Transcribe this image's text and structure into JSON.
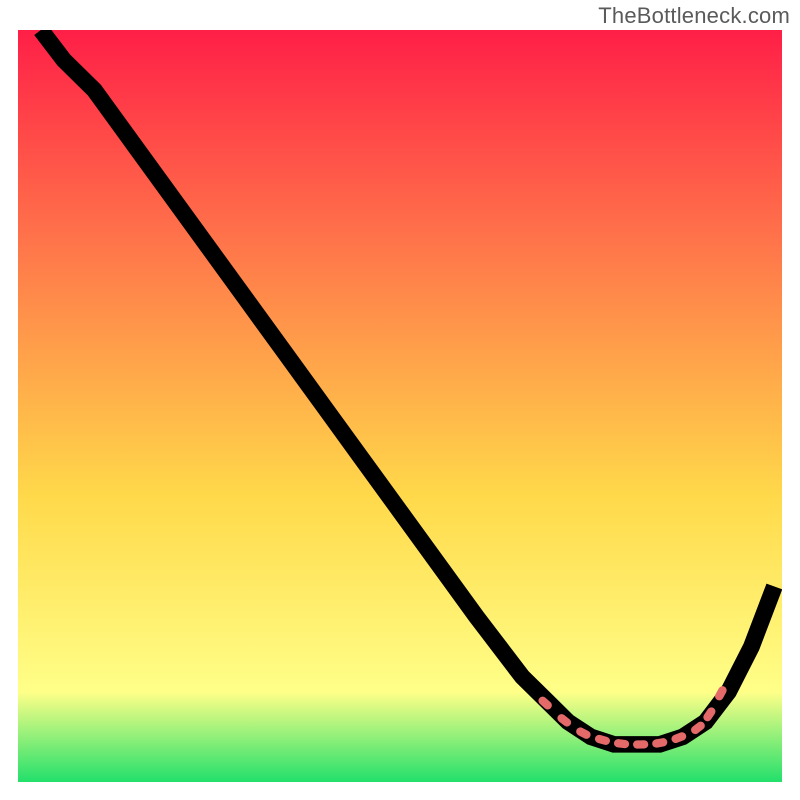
{
  "watermark": "TheBottleneck.com",
  "colors": {
    "grad_top": "#ff1f47",
    "grad_mid1": "#ff7a4a",
    "grad_mid2": "#ffd94a",
    "grad_mid3": "#ffff88",
    "grad_bottom": "#22e06b",
    "curve": "#000000",
    "bead": "#e46a6a"
  },
  "chart_data": {
    "type": "line",
    "title": "",
    "xlabel": "",
    "ylabel": "",
    "xlim": [
      0,
      100
    ],
    "ylim": [
      0,
      100
    ],
    "series": [
      {
        "name": "curve",
        "x": [
          3,
          6,
          10,
          15,
          20,
          25,
          30,
          35,
          40,
          45,
          50,
          55,
          60,
          63,
          66,
          69,
          72,
          75,
          78,
          81,
          84,
          87,
          90,
          93,
          96,
          99
        ],
        "y": [
          100,
          96,
          92,
          85,
          78,
          71,
          64,
          57,
          50,
          43,
          36,
          29,
          22,
          18,
          14,
          11,
          8,
          6,
          5,
          5,
          5,
          6,
          8,
          12,
          18,
          26
        ]
      }
    ],
    "beads": {
      "x": [
        69,
        71.5,
        74,
        76.5,
        79,
        81.5,
        84,
        86.5,
        89,
        90.5,
        92
      ],
      "y": [
        10.5,
        8.2,
        6.5,
        5.6,
        5.1,
        5.0,
        5.2,
        5.9,
        7.2,
        9.0,
        11.8
      ]
    }
  }
}
